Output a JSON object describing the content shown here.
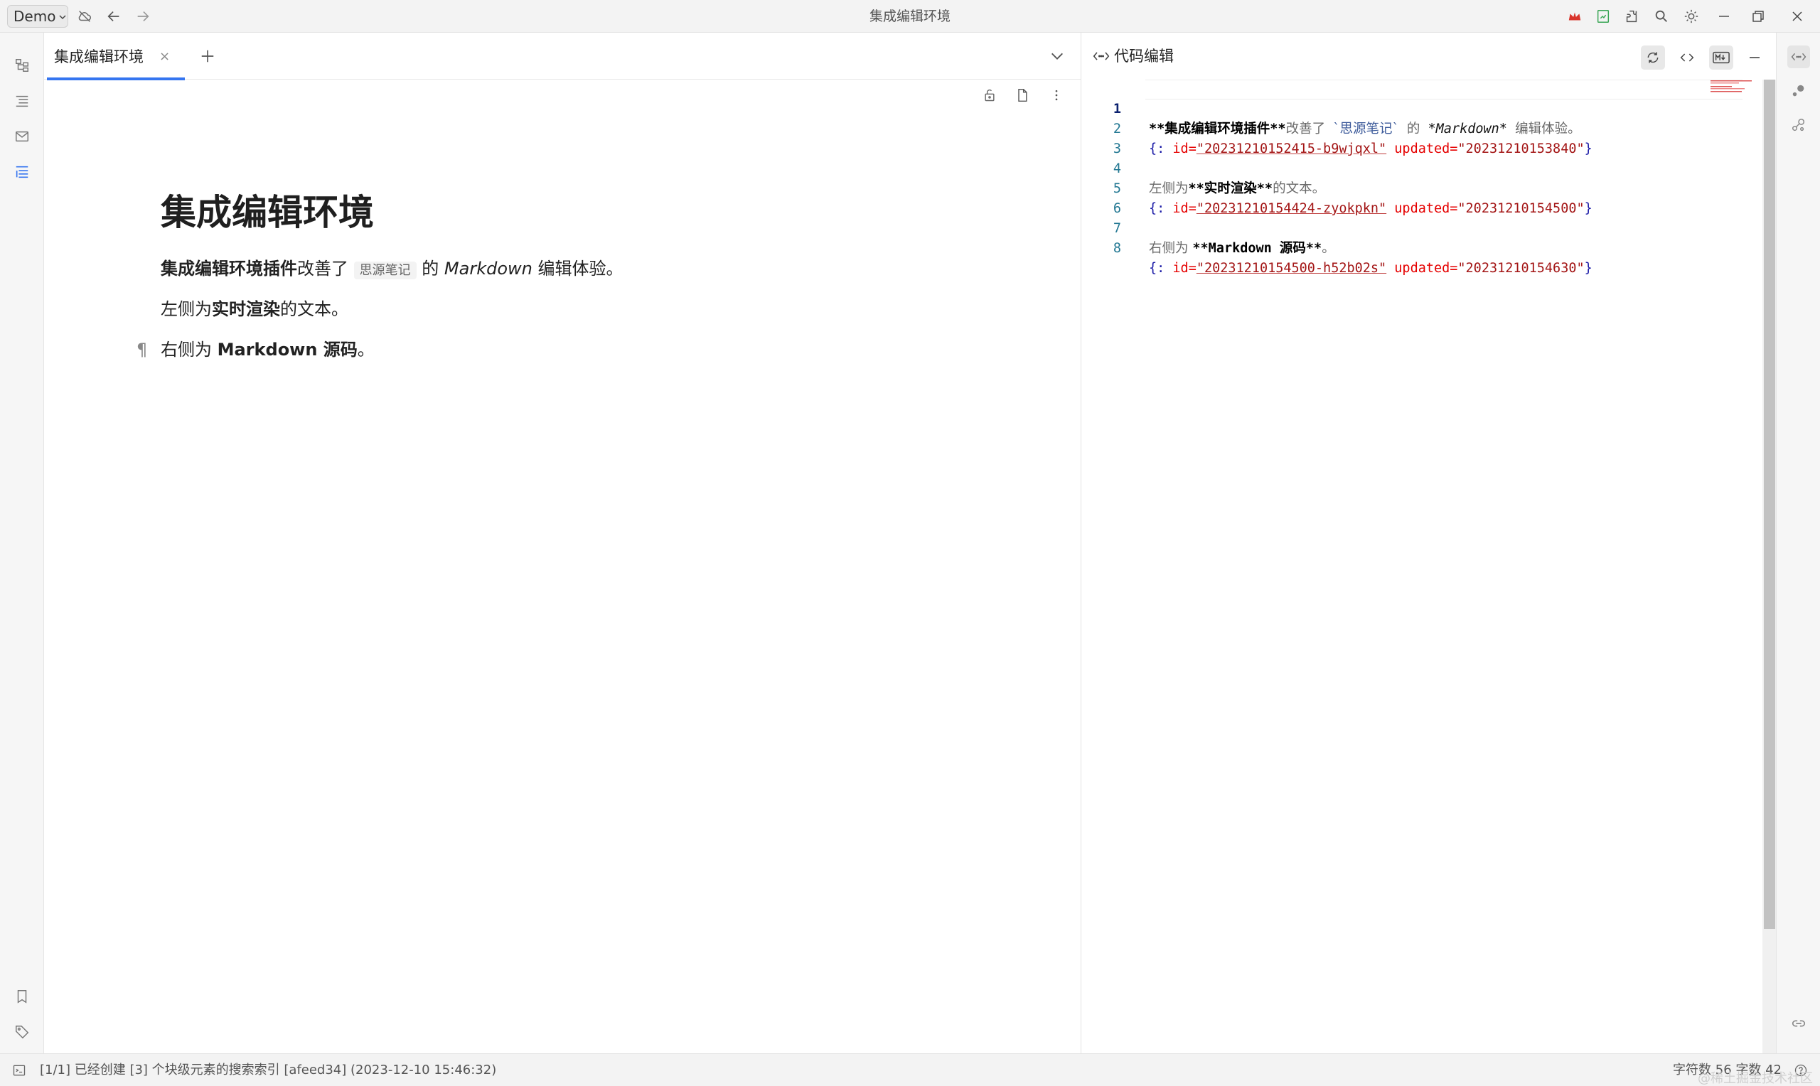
{
  "titlebar": {
    "workspace": "Demo",
    "window_title": "集成编辑环境"
  },
  "tab": {
    "label": "集成编辑环境",
    "close": "×"
  },
  "doc": {
    "title": "集成编辑环境",
    "p1": {
      "bold": "集成编辑环境插件",
      "t1": "改善了",
      "code": "思源笔记",
      "t2": "的",
      "italic": "Markdown",
      "t3": "编辑体验。"
    },
    "p2": {
      "t1": "左侧为",
      "bold": "实时渲染",
      "t2": "的文本。"
    },
    "p3": {
      "pilcrow": "¶",
      "t1": "右侧为",
      "bold": "Markdown 源码",
      "t2": "。"
    }
  },
  "code_panel": {
    "title": "代码编辑",
    "lines": [
      {
        "num": "1"
      },
      {
        "num": "2"
      },
      {
        "num": "3"
      },
      {
        "num": "4"
      },
      {
        "num": "5"
      },
      {
        "num": "6"
      },
      {
        "num": "7"
      },
      {
        "num": "8"
      }
    ],
    "l1": {
      "b1": "**集成编辑环境插件**",
      "t1": "改善了",
      "c1": "`思源笔记`",
      "t2": "的",
      "i1": "*Markdown*",
      "t3": "编辑体验。"
    },
    "l2": {
      "open": "{: ",
      "k1": "id=",
      "v1": "\"20231210152415-b9wjqxl\"",
      "k2": " updated=",
      "v2": "\"20231210153840\"",
      "close": "}"
    },
    "l4": {
      "t1": "左侧为",
      "b1": "**实时渲染**",
      "t2": "的文本。"
    },
    "l5": {
      "open": "{: ",
      "k1": "id=",
      "v1": "\"20231210154424-zyokpkn\"",
      "k2": " updated=",
      "v2": "\"20231210154500\"",
      "close": "}"
    },
    "l7": {
      "t1": "右侧为 ",
      "b1": "**Markdown 源码**",
      "t2": "。"
    },
    "l8": {
      "open": "{: ",
      "k1": "id=",
      "v1": "\"20231210154500-h52b02s\"",
      "k2": " updated=",
      "v2": "\"20231210154630\"",
      "close": "}"
    }
  },
  "status": {
    "message": "[1/1] 已经创建 [3] 个块级元素的搜索索引 [afeed34] (2023-12-10 15:46:32)",
    "counts": "字符数 56  字数 42",
    "watermark": "@稀土掘金技术社区"
  },
  "colors": {
    "accent": "#3575f0",
    "crown": "#d9342b",
    "sync_green": "#3aa655"
  }
}
